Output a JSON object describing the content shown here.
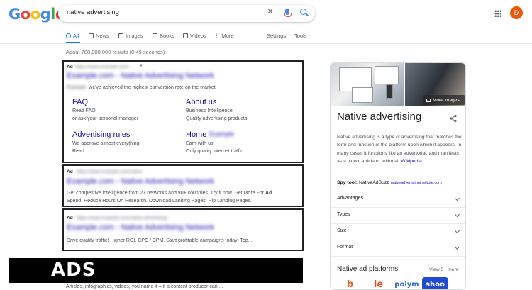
{
  "search": {
    "query": "native advertising"
  },
  "header": {
    "avatar_letter": "D"
  },
  "tabs": [
    {
      "label": "All",
      "active": true
    },
    {
      "label": "News"
    },
    {
      "label": "Images"
    },
    {
      "label": "Books"
    },
    {
      "label": "Videos"
    },
    {
      "label": "More"
    }
  ],
  "tools": {
    "settings": "Settings",
    "tools": "Tools"
  },
  "stats": "About 788,000,000 results (0.49 seconds)",
  "ads": [
    {
      "label": "Ad",
      "url_blurred": "https://www.example.com/",
      "title_blurred": "Example.com - Native Advertising Network",
      "desc_blurred": "Example",
      "desc": "- we've achieved the highest conversion rate on the market.",
      "sitelinks": [
        {
          "title": "FAQ",
          "line1": "Read FAQ",
          "line2": "or ask your personal manager"
        },
        {
          "title": "About us",
          "line1": "Business Intelligence",
          "line2": "Quality advertising products"
        },
        {
          "title": "Advertising rules",
          "line1": "We approve almost everything",
          "line2": "Read"
        },
        {
          "title": "Home",
          "title_blurred": "Example",
          "line1": "Earn with us!",
          "line2": "Only quality internet traffic"
        }
      ]
    },
    {
      "label": "Ad",
      "url_blurred": "https://www.example.com/native",
      "title_blurred": "Example.com - Native Advertising Network",
      "desc1_before": "Get competitive intelligence from 27 networks and 90+ countries. Try it now. Get More For ",
      "desc1_bold": "Ad",
      "desc2": "Spend. Reduce Hours On Research. Download Landing Pages. Rip Landing Pages."
    },
    {
      "label": "Ad",
      "url_blurred": "https://www.example.com/native-advertising/",
      "title_blurred": "Example.com - Native Advertising Network",
      "desc": "Drive quality traffic! Higher ROI. CPC / CPM. Start profitable campaigns today! Top..."
    }
  ],
  "overlay": {
    "caption": "ADS"
  },
  "organic_peek": "Articles, infographics, videos, you name it – if a content producer can ...",
  "knowledge_panel": {
    "more_images": "More images",
    "title": "Native advertising",
    "desc": "Native advertising is a type of advertising that matches the form and function of the platform upon which it appears. In many cases it functions like an advertorial, and manifests as a video, article or editorial.",
    "wiki": "Wikipedia",
    "spy_label": "Spy tool:",
    "spy_value": "NativeAdBuzz",
    "spy_link": "nativeadvertisinginstitute.com",
    "rows": [
      "Advantages",
      "Types",
      "Size",
      "Format"
    ],
    "platforms_title": "Native ad platforms",
    "view_more": "View 5+ more",
    "platform_logos": [
      "b",
      "le",
      "polym",
      "shoo"
    ]
  },
  "colors": {
    "link": "#1a0dab",
    "accent": "#1a73e8",
    "avatar": "#e8590c"
  }
}
